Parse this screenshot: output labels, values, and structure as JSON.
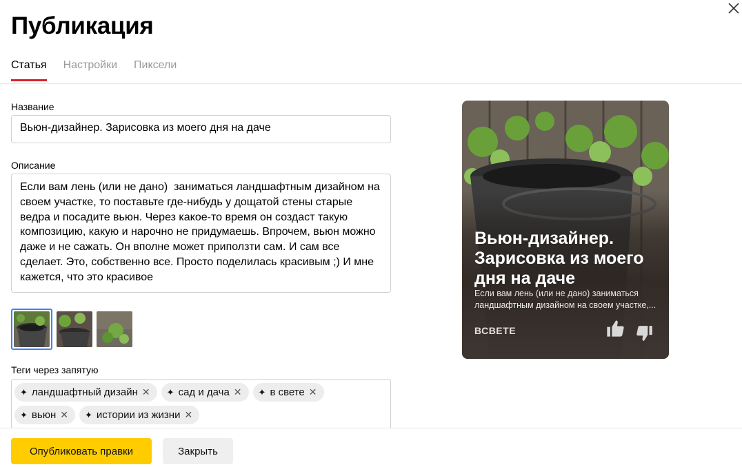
{
  "dialog": {
    "title": "Публикация"
  },
  "tabs": [
    {
      "label": "Статья",
      "active": true
    },
    {
      "label": "Настройки",
      "active": false
    },
    {
      "label": "Пиксели",
      "active": false
    }
  ],
  "form": {
    "name_label": "Название",
    "name_value": "Вьюн-дизайнер. Зарисовка из моего дня на даче",
    "description_label": "Описание",
    "description_value": "Если вам лень (или не дано)  заниматься ландшафтным дизайном на своем участке, то поставьте где-нибудь у дощатой стены старые ведра и посадите вьюн. Через какое-то время он создаст такую композицию, какую и нарочно не придумаешь. Впрочем, вьюн можно даже и не сажать. Он вполне может приползти сам. И сам все сделает. Это, собственно все. Просто поделилась красивым ;) И мне кажется, что это красивое",
    "tags_label": "Теги через запятую",
    "tags": [
      "ландшафтный дизайн",
      "сад и дача",
      "в свете",
      "вьюн",
      "истории из жизни"
    ]
  },
  "preview": {
    "title": "Вьюн-дизайнер. Зарисовка из моего дня на даче",
    "description": "Если вам лень (или не дано) заниматься ландшафтным дизайном на своем участке,...",
    "source": "ВСВЕТЕ"
  },
  "footer": {
    "publish_label": "Опубликовать правки",
    "close_label": "Закрыть"
  },
  "colors": {
    "accent_tab": "#d9232e",
    "primary_button": "#ffcc00",
    "selected_thumb": "#3b82f6"
  },
  "icons": [
    "close-icon",
    "sparkle-icon",
    "remove-tag-icon",
    "thumbs-up-icon",
    "thumbs-down-icon"
  ]
}
